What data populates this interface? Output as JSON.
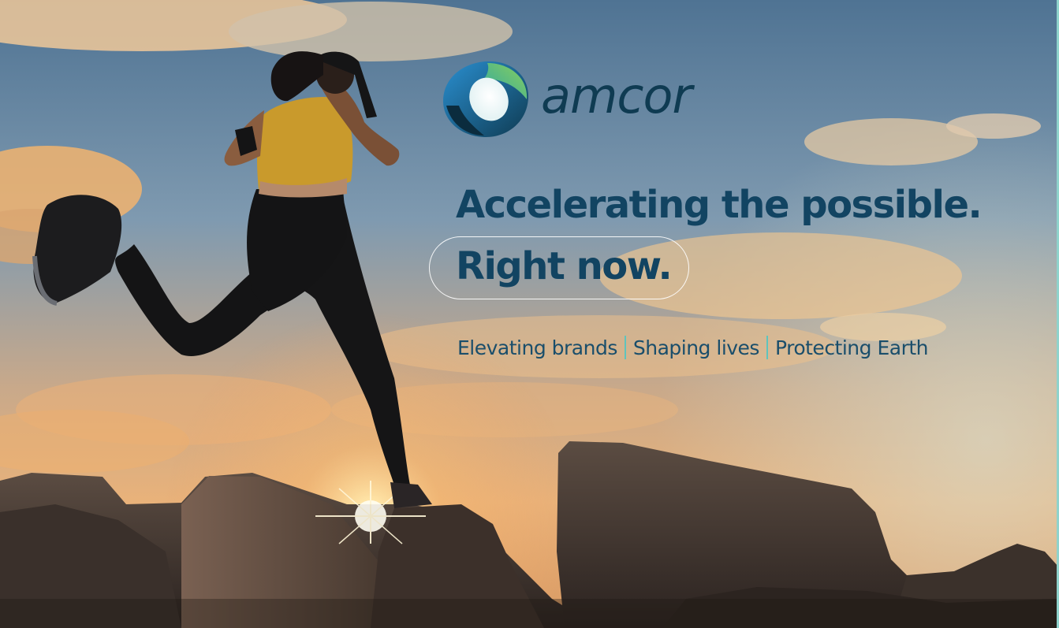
{
  "brand": {
    "name": "amcor",
    "logo_colors": {
      "dark_blue": "#0f3b52",
      "mid_blue": "#1f6fa5",
      "green": "#4fb85a",
      "teal": "#3aa5a8"
    }
  },
  "hero": {
    "headline": "Accelerating the possible.",
    "subheadline": "Right now.",
    "taglines": [
      "Elevating brands",
      "Shaping lives",
      "Protecting Earth"
    ],
    "text_color": "#124462",
    "separator_color": "#5fc4bd"
  },
  "background": {
    "subject": "runner silhouette leaping across rocks at sunset",
    "sky_top_color": "#5d7f9c",
    "sky_glow_color": "#f2b36b",
    "rock_color": "#3e3530"
  }
}
